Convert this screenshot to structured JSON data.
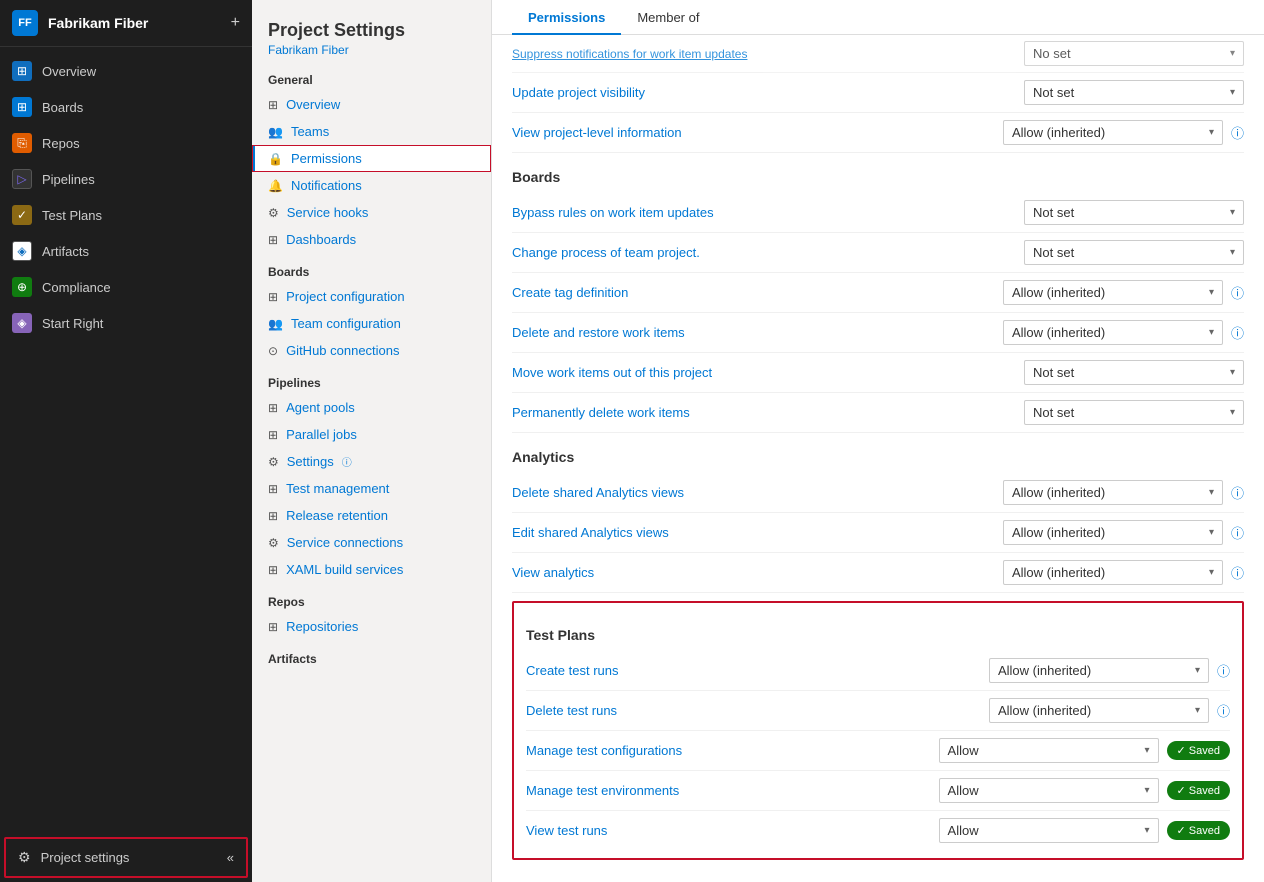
{
  "app": {
    "logo": "FF",
    "title": "Fabrikam Fiber",
    "add_label": "+"
  },
  "nav": {
    "items": [
      {
        "id": "overview",
        "label": "Overview",
        "icon": "overview",
        "icon_char": "⊞"
      },
      {
        "id": "boards",
        "label": "Boards",
        "icon": "boards",
        "icon_char": "⊞"
      },
      {
        "id": "repos",
        "label": "Repos",
        "icon": "repos",
        "icon_char": "⎘"
      },
      {
        "id": "pipelines",
        "label": "Pipelines",
        "icon": "pipelines",
        "icon_char": "⊳"
      },
      {
        "id": "testplans",
        "label": "Test Plans",
        "icon": "testplans",
        "icon_char": "✓"
      },
      {
        "id": "artifacts",
        "label": "Artifacts",
        "icon": "artifacts",
        "icon_char": "◈"
      },
      {
        "id": "compliance",
        "label": "Compliance",
        "icon": "compliance",
        "icon_char": "⊕"
      },
      {
        "id": "startright",
        "label": "Start Right",
        "icon": "startright",
        "icon_char": "◈"
      }
    ],
    "bottom": {
      "label": "Project settings",
      "icon": "⚙"
    },
    "collapse_icon": "«"
  },
  "middle": {
    "title": "Project Settings",
    "subtitle": "Fabrikam Fiber",
    "sections": [
      {
        "label": "General",
        "items": [
          {
            "id": "overview",
            "label": "Overview",
            "icon": "⊞"
          },
          {
            "id": "teams",
            "label": "Teams",
            "icon": "👥"
          },
          {
            "id": "permissions",
            "label": "Permissions",
            "icon": "🔒",
            "active": true
          },
          {
            "id": "notifications",
            "label": "Notifications",
            "icon": "🔔"
          },
          {
            "id": "servicehooks",
            "label": "Service hooks",
            "icon": "⚙"
          },
          {
            "id": "dashboards",
            "label": "Dashboards",
            "icon": "⊞"
          }
        ]
      },
      {
        "label": "Boards",
        "items": [
          {
            "id": "projectconfig",
            "label": "Project configuration",
            "icon": "⊞"
          },
          {
            "id": "teamconfig",
            "label": "Team configuration",
            "icon": "👥"
          },
          {
            "id": "githubconn",
            "label": "GitHub connections",
            "icon": "⊙"
          }
        ]
      },
      {
        "label": "Pipelines",
        "items": [
          {
            "id": "agentpools",
            "label": "Agent pools",
            "icon": "⊞"
          },
          {
            "id": "paralleljobs",
            "label": "Parallel jobs",
            "icon": "⊞"
          },
          {
            "id": "settings",
            "label": "Settings",
            "icon": "⚙",
            "info": true
          },
          {
            "id": "testmgmt",
            "label": "Test management",
            "icon": "⊞"
          },
          {
            "id": "releaseretention",
            "label": "Release retention",
            "icon": "⊞"
          },
          {
            "id": "serviceconn",
            "label": "Service connections",
            "icon": "⚙"
          },
          {
            "id": "xaml",
            "label": "XAML build services",
            "icon": "⊞"
          }
        ]
      },
      {
        "label": "Repos",
        "items": [
          {
            "id": "repositories",
            "label": "Repositories",
            "icon": "⊞"
          }
        ]
      },
      {
        "label": "Artifacts",
        "items": []
      }
    ]
  },
  "tabs": [
    {
      "id": "permissions",
      "label": "Permissions",
      "active": true
    },
    {
      "id": "memberof",
      "label": "Member of",
      "active": false
    }
  ],
  "content": {
    "top_cut": {
      "label": "Suppress notifications for work item updates",
      "value": "No set",
      "visible": true
    },
    "general_rows": [
      {
        "id": "update_visibility",
        "label": "Update project visibility",
        "value": "Not set",
        "has_info": false
      },
      {
        "id": "view_project_info",
        "label": "View project-level information",
        "value": "Allow (inherited)",
        "has_info": true
      }
    ],
    "boards_section": {
      "title": "Boards",
      "rows": [
        {
          "id": "bypass_rules",
          "label": "Bypass rules on work item updates",
          "value": "Not set",
          "has_info": false
        },
        {
          "id": "change_process",
          "label": "Change process of team project.",
          "value": "Not set",
          "has_info": false
        },
        {
          "id": "create_tag",
          "label": "Create tag definition",
          "value": "Allow (inherited)",
          "has_info": true
        },
        {
          "id": "delete_restore",
          "label": "Delete and restore work items",
          "value": "Allow (inherited)",
          "has_info": true
        },
        {
          "id": "move_work_items",
          "label": "Move work items out of this project",
          "value": "Not set",
          "has_info": false
        },
        {
          "id": "perm_delete",
          "label": "Permanently delete work items",
          "value": "Not set",
          "has_info": false
        }
      ]
    },
    "analytics_section": {
      "title": "Analytics",
      "rows": [
        {
          "id": "delete_analytics",
          "label": "Delete shared Analytics views",
          "value": "Allow (inherited)",
          "has_info": true
        },
        {
          "id": "edit_analytics",
          "label": "Edit shared Analytics views",
          "value": "Allow (inherited)",
          "has_info": true
        },
        {
          "id": "view_analytics",
          "label": "View analytics",
          "value": "Allow (inherited)",
          "has_info": true
        }
      ]
    },
    "testplans_section": {
      "title": "Test Plans",
      "highlighted": true,
      "rows": [
        {
          "id": "create_test_runs",
          "label": "Create test runs",
          "value": "Allow (inherited)",
          "has_info": true,
          "saved": false
        },
        {
          "id": "delete_test_runs",
          "label": "Delete test runs",
          "value": "Allow (inherited)",
          "has_info": true,
          "saved": false
        },
        {
          "id": "manage_test_configs",
          "label": "Manage test configurations",
          "value": "Allow",
          "has_info": false,
          "saved": true
        },
        {
          "id": "manage_test_envs",
          "label": "Manage test environments",
          "value": "Allow",
          "has_info": false,
          "saved": true
        },
        {
          "id": "view_test_runs",
          "label": "View test runs",
          "value": "Allow",
          "has_info": false,
          "saved": true
        }
      ]
    },
    "saved_label": "✓ Saved"
  }
}
